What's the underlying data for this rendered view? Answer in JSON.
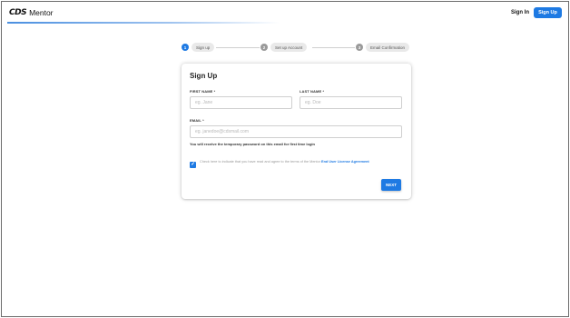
{
  "header": {
    "logo_mark": "CDS",
    "logo_text": "Mentor",
    "signin_label": "Sign In",
    "signup_label": "Sign Up"
  },
  "stepper": {
    "steps": [
      {
        "number": "1",
        "label": "Sign up",
        "state": "active"
      },
      {
        "number": "2",
        "label": "Set up Account",
        "state": "inactive"
      },
      {
        "number": "3",
        "label": "Email Confirmation",
        "state": "inactive"
      }
    ]
  },
  "form": {
    "title": "Sign Up",
    "first_name": {
      "label": "FIRST NAME *",
      "placeholder": "eg. Jane",
      "value": ""
    },
    "last_name": {
      "label": "LAST NAME *",
      "placeholder": "eg. Doe",
      "value": ""
    },
    "email": {
      "label": "EMAIL *",
      "placeholder": "eg. janedoe@cdsmail.com",
      "value": ""
    },
    "helper_text": "You will receive the temporary password on this email for first time login",
    "agreement": {
      "checked": true,
      "text": "Check here to indicate that you have read and agree to the terms of the Mentor",
      "link_text": "End User License Agreement"
    },
    "next_label": "NEXT"
  },
  "colors": {
    "accent": "#1e7ae3",
    "inactive_step": "#9a9a9a"
  }
}
